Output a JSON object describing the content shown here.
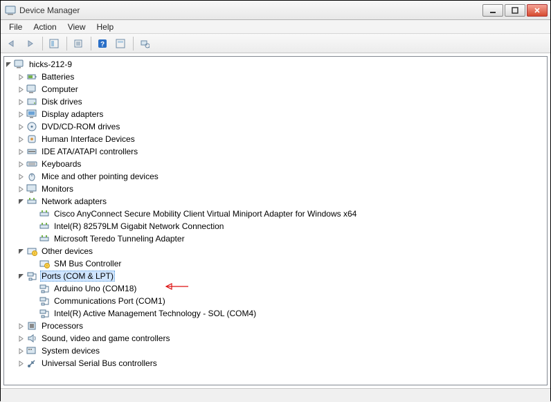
{
  "window": {
    "title": "Device Manager"
  },
  "menu": {
    "file": "File",
    "action": "Action",
    "view": "View",
    "help": "Help"
  },
  "tree": {
    "root": {
      "label": "hicks-212-9",
      "children": {
        "batteries": "Batteries",
        "computer": "Computer",
        "disk_drives": "Disk drives",
        "display_adapters": "Display adapters",
        "dvd": "DVD/CD-ROM drives",
        "hid": "Human Interface Devices",
        "ide": "IDE ATA/ATAPI controllers",
        "keyboards": "Keyboards",
        "mice": "Mice and other pointing devices",
        "monitors": "Monitors",
        "network": {
          "label": "Network adapters",
          "items": [
            "Cisco AnyConnect Secure Mobility Client Virtual Miniport Adapter for Windows x64",
            "Intel(R) 82579LM Gigabit Network Connection",
            "Microsoft Teredo Tunneling Adapter"
          ]
        },
        "other": {
          "label": "Other devices",
          "items": [
            "SM Bus Controller"
          ]
        },
        "ports": {
          "label": "Ports (COM & LPT)",
          "items": [
            "Arduino Uno (COM18)",
            "Communications Port (COM1)",
            "Intel(R) Active Management Technology - SOL (COM4)"
          ]
        },
        "processors": "Processors",
        "sound": "Sound, video and game controllers",
        "system": "System devices",
        "usb": "Universal Serial Bus controllers"
      }
    }
  },
  "selected_node": "Ports (COM & LPT)"
}
